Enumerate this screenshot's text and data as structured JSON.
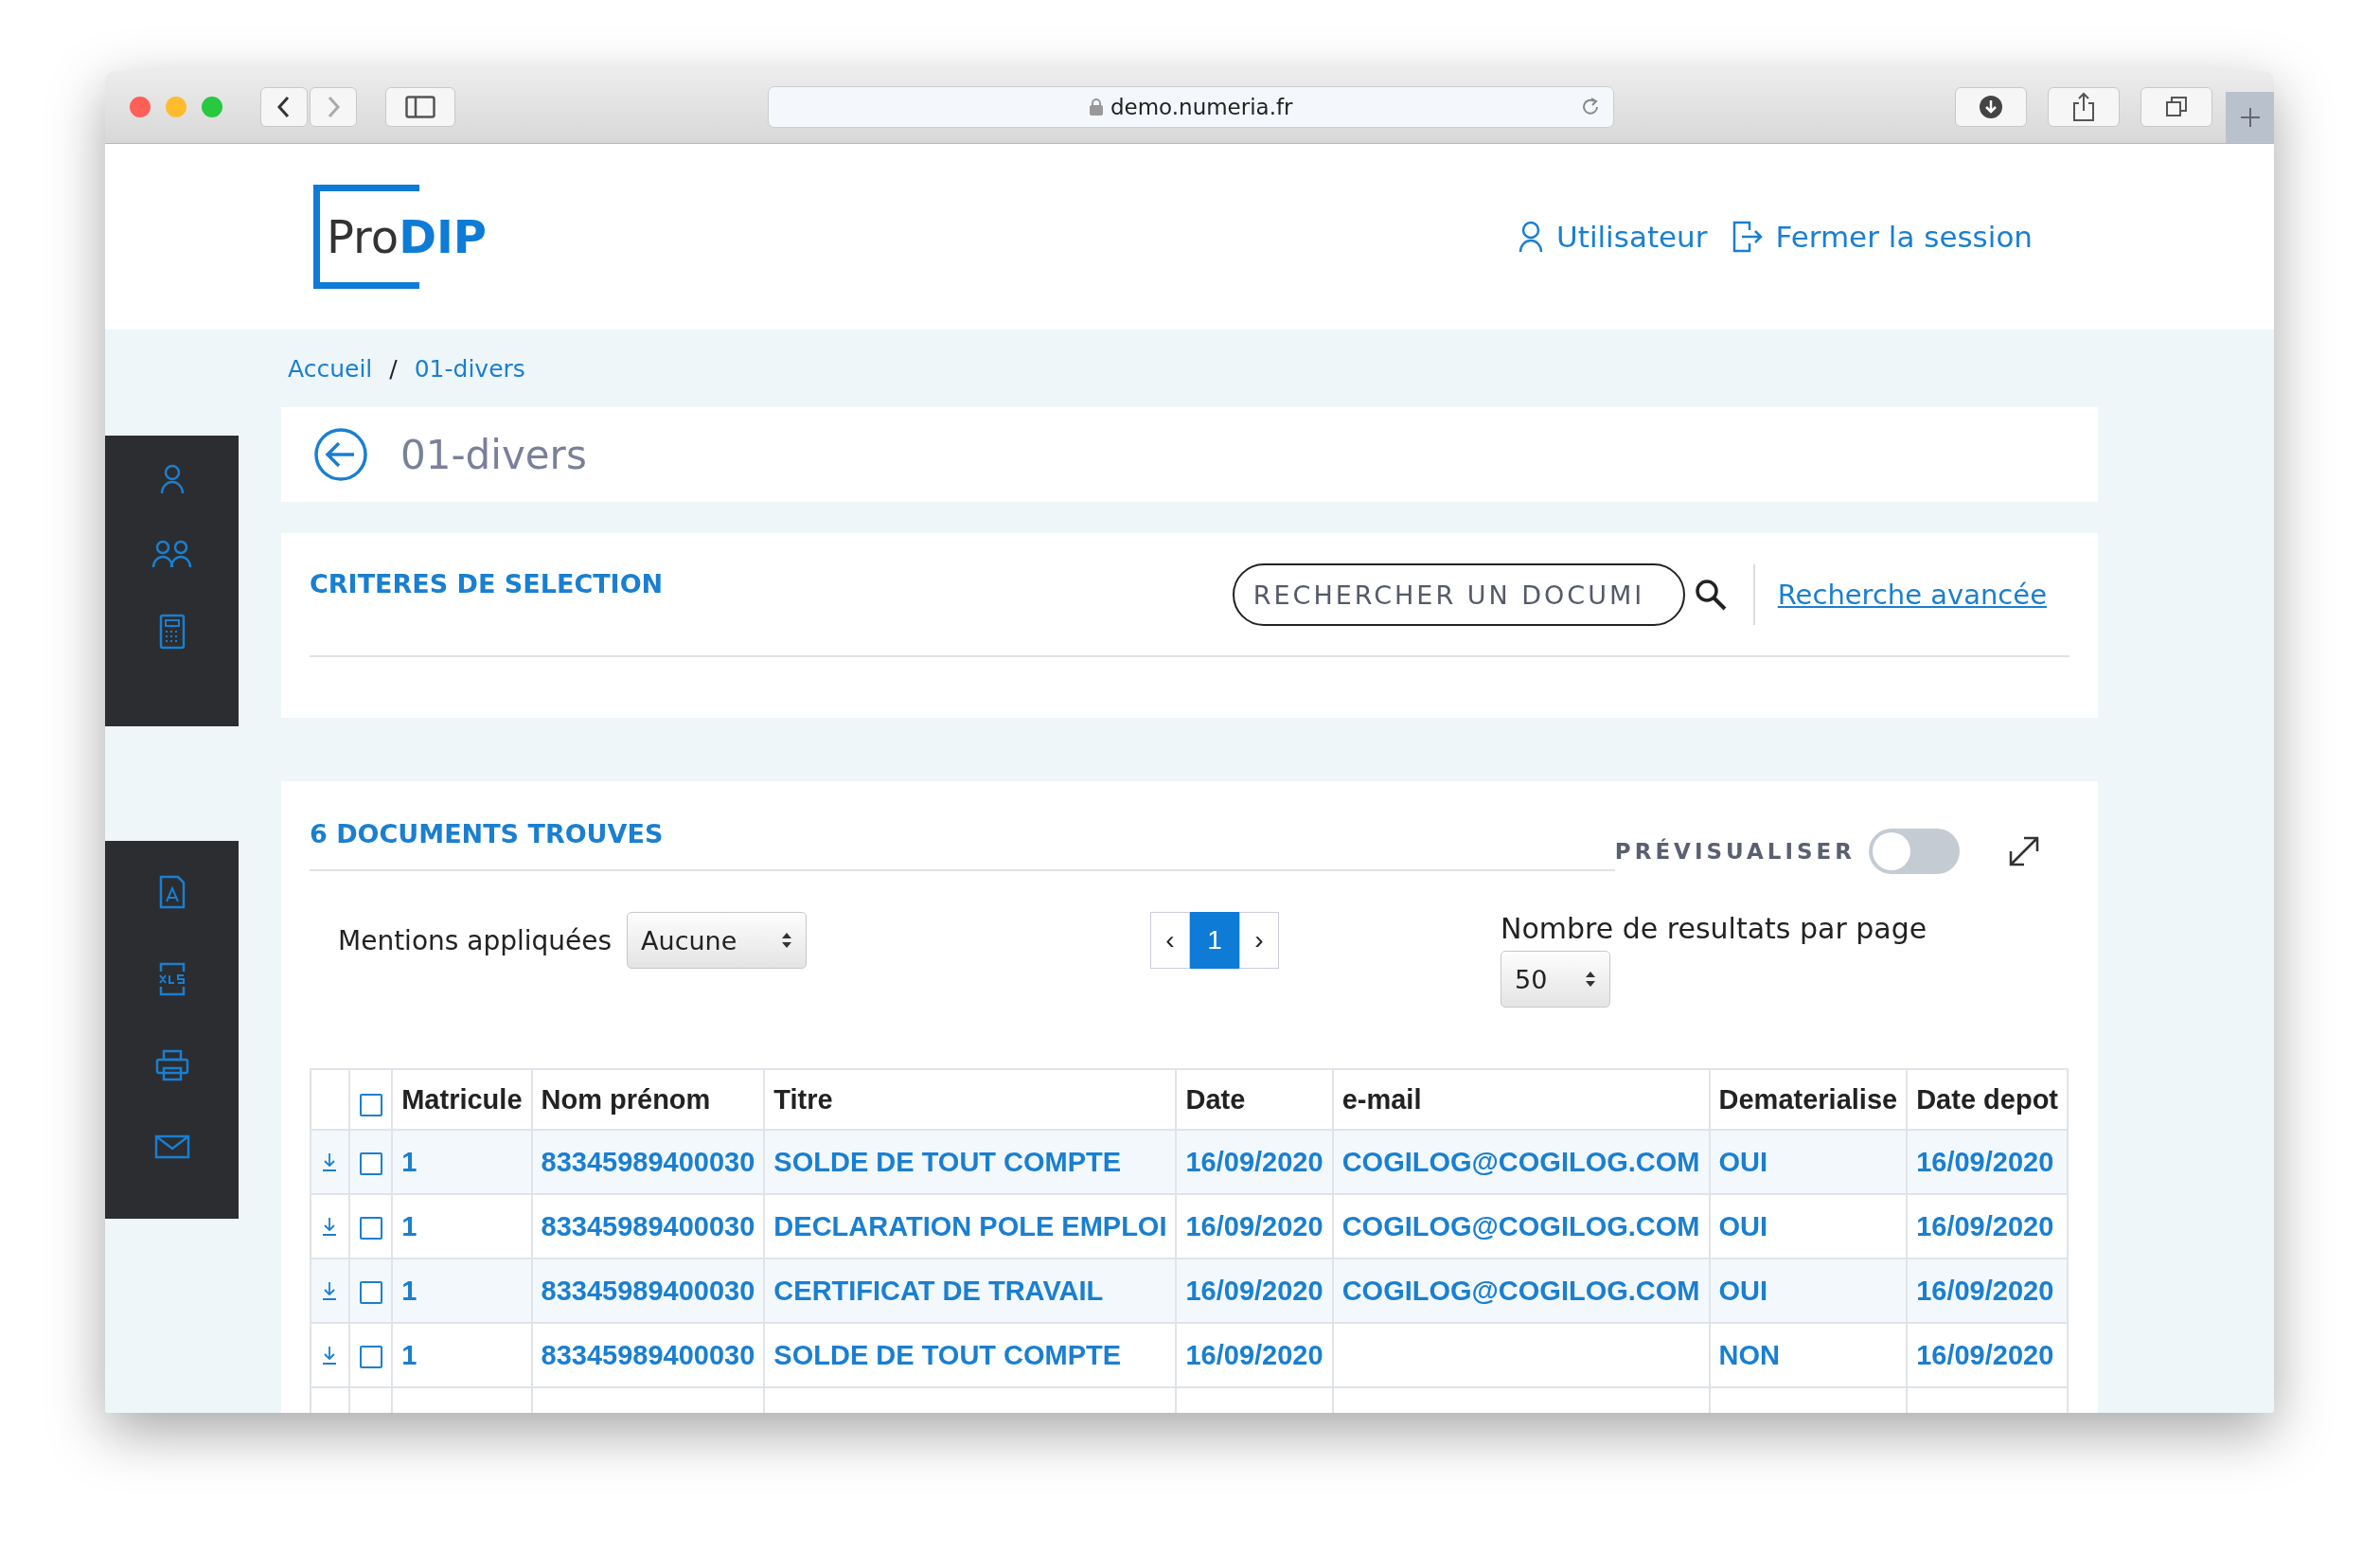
{
  "browser": {
    "url": "demo.numeria.fr"
  },
  "header": {
    "logo_prefix": "Pro",
    "logo_suffix": "DIP",
    "links": [
      {
        "kind": "user",
        "label": "Utilisateur"
      },
      {
        "kind": "logout",
        "label": "Fermer la session"
      }
    ]
  },
  "breadcrumb": {
    "items": [
      "Accueil",
      "01-divers"
    ],
    "separator": "/"
  },
  "page_title": "01-divers",
  "criteria": {
    "title": "CRITERES DE SELECTION",
    "search_placeholder": "RECHERCHER UN DOCUMI",
    "advanced_link": "Recherche avancée"
  },
  "results": {
    "title": "6 DOCUMENTS TROUVES",
    "preview": {
      "label": "PRÉVISUALISER",
      "on": false
    },
    "mentions": {
      "label": "Mentions appliquées",
      "value": "Aucune"
    },
    "pagination": {
      "prev": "‹",
      "pages": [
        {
          "label": "1",
          "selected": true
        }
      ],
      "next": "›"
    },
    "per_page": {
      "label": "Nombre de resultats par page",
      "value": "50"
    },
    "table": {
      "header_checked": false,
      "columns": [
        "Matricule",
        "Nom prénom",
        "Titre",
        "Date",
        "e-mail",
        "Dematerialise",
        "Date depot"
      ],
      "rows": [
        {
          "checked": false,
          "cells": [
            "1",
            "83345989400030",
            "SOLDE DE TOUT COMPTE",
            "16/09/2020",
            "COGILOG@COGILOG.COM",
            "OUI",
            "16/09/2020"
          ]
        },
        {
          "checked": false,
          "cells": [
            "1",
            "83345989400030",
            "DECLARATION POLE EMPLOI",
            "16/09/2020",
            "COGILOG@COGILOG.COM",
            "OUI",
            "16/09/2020"
          ]
        },
        {
          "checked": false,
          "cells": [
            "1",
            "83345989400030",
            "CERTIFICAT DE TRAVAIL",
            "16/09/2020",
            "COGILOG@COGILOG.COM",
            "OUI",
            "16/09/2020"
          ]
        },
        {
          "checked": false,
          "cells": [
            "1",
            "83345989400030",
            "SOLDE DE TOUT COMPTE",
            "16/09/2020",
            "",
            "NON",
            "16/09/2020"
          ]
        }
      ]
    }
  }
}
